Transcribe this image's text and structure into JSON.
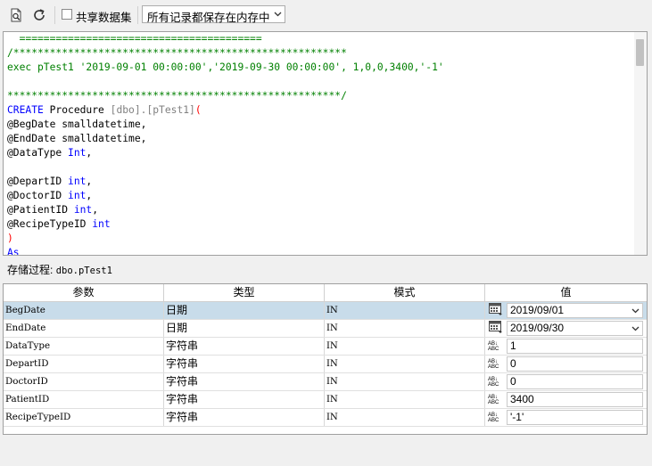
{
  "toolbar": {
    "share_dataset_label": "共享数据集",
    "share_dataset_checked": false,
    "storage_select_value": "所有记录都保存在内存中"
  },
  "editor": {
    "lines": [
      [
        {
          "t": "  ========================================",
          "c": "cm"
        }
      ],
      [
        {
          "t": "/*******************************************************",
          "c": "cm"
        }
      ],
      [
        {
          "t": "exec pTest1 '2019-09-01 00:00:00','2019-09-30 00:00:00', 1,0,0,3400,'-1'",
          "c": "cm"
        }
      ],
      [
        {
          "t": "",
          "c": ""
        }
      ],
      [
        {
          "t": "*******************************************************/",
          "c": "cm"
        }
      ],
      [
        {
          "t": "CREATE",
          "c": "kw"
        },
        {
          "t": " Procedure ",
          "c": ""
        },
        {
          "t": "[dbo].[pTest1]",
          "c": "gr"
        },
        {
          "t": "(",
          "c": "rd"
        }
      ],
      [
        {
          "t": "@BegDate smalldatetime,",
          "c": ""
        }
      ],
      [
        {
          "t": "@EndDate smalldatetime,",
          "c": ""
        }
      ],
      [
        {
          "t": "@DataType ",
          "c": ""
        },
        {
          "t": "Int",
          "c": "kw"
        },
        {
          "t": ",",
          "c": ""
        }
      ],
      [
        {
          "t": "",
          "c": ""
        }
      ],
      [
        {
          "t": "@DepartID ",
          "c": ""
        },
        {
          "t": "int",
          "c": "kw"
        },
        {
          "t": ",",
          "c": ""
        }
      ],
      [
        {
          "t": "@DoctorID ",
          "c": ""
        },
        {
          "t": "int",
          "c": "kw"
        },
        {
          "t": ",",
          "c": ""
        }
      ],
      [
        {
          "t": "@PatientID ",
          "c": ""
        },
        {
          "t": "int",
          "c": "kw"
        },
        {
          "t": ",",
          "c": ""
        }
      ],
      [
        {
          "t": "@RecipeTypeID ",
          "c": ""
        },
        {
          "t": "int",
          "c": "kw"
        }
      ],
      [
        {
          "t": ")",
          "c": "rd"
        }
      ],
      [
        {
          "t": "As",
          "c": "kw"
        }
      ]
    ]
  },
  "procedure": {
    "label": "存储过程:",
    "name": "dbo.pTest1"
  },
  "grid": {
    "headers": {
      "param": "参数",
      "type": "类型",
      "mode": "模式",
      "value": "值"
    },
    "rows": [
      {
        "param": "BegDate",
        "type": "日期",
        "mode": "IN",
        "icon": "calendar-icon",
        "value": "2019/09/01",
        "dropdown": true,
        "selected": true
      },
      {
        "param": "EndDate",
        "type": "日期",
        "mode": "IN",
        "icon": "calendar-icon",
        "value": "2019/09/30",
        "dropdown": true,
        "selected": false
      },
      {
        "param": "DataType",
        "type": "字符串",
        "mode": "IN",
        "icon": "abc-icon",
        "value": "1",
        "dropdown": false,
        "selected": false
      },
      {
        "param": "DepartID",
        "type": "字符串",
        "mode": "IN",
        "icon": "abc-icon",
        "value": "0",
        "dropdown": false,
        "selected": false
      },
      {
        "param": "DoctorID",
        "type": "字符串",
        "mode": "IN",
        "icon": "abc-icon",
        "value": "0",
        "dropdown": false,
        "selected": false
      },
      {
        "param": "PatientID",
        "type": "字符串",
        "mode": "IN",
        "icon": "abc-icon",
        "value": "3400",
        "dropdown": false,
        "selected": false
      },
      {
        "param": "RecipeTypeID",
        "type": "字符串",
        "mode": "IN",
        "icon": "abc-icon",
        "value": "'-1'",
        "dropdown": false,
        "selected": false
      }
    ]
  },
  "icons": {
    "preview": "preview-icon",
    "refresh": "refresh-icon",
    "calendar": "calendar-icon",
    "abc": "abc-icon"
  },
  "abc_icon_text": {
    "top": "AB↓",
    "bottom": "ABC"
  },
  "colors": {
    "comment": "#008000",
    "keyword": "#0000ff",
    "identifier": "#808080",
    "paren": "#ff0000",
    "selected_row": "#c8dcea"
  }
}
